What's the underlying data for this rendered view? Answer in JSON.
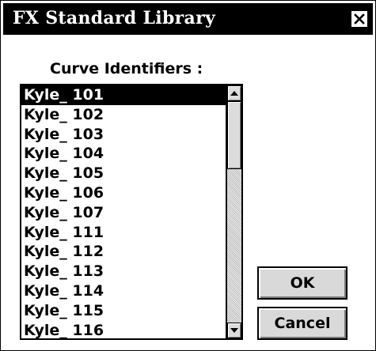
{
  "window": {
    "title": "FX Standard Library"
  },
  "list": {
    "label": "Curve Identifiers :",
    "selected_index": 0,
    "items": [
      "Kyle_ 101",
      "Kyle_ 102",
      "Kyle_ 103",
      "Kyle_ 104",
      "Kyle_ 105",
      "Kyle_ 106",
      "Kyle_ 107",
      "Kyle_ 111",
      "Kyle_ 112",
      "Kyle_ 113",
      "Kyle_ 114",
      "Kyle_ 115",
      "Kyle_ 116"
    ]
  },
  "buttons": {
    "ok": "OK",
    "cancel": "Cancel"
  },
  "icons": {
    "close": "close-icon",
    "scroll_up": "arrow-up-icon",
    "scroll_down": "arrow-down-icon"
  }
}
